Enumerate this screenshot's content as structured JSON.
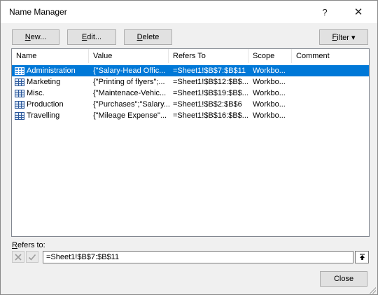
{
  "window": {
    "title": "Name Manager",
    "help_glyph": "?",
    "close_glyph": "✕"
  },
  "toolbar": {
    "new_pre": "",
    "new_u": "N",
    "new_post": "ew...",
    "edit_pre": "",
    "edit_u": "E",
    "edit_post": "dit...",
    "delete_pre": "",
    "delete_u": "D",
    "delete_post": "elete",
    "filter_pre": "",
    "filter_u": "F",
    "filter_post": "ilter ▾"
  },
  "table": {
    "columns": [
      "Name",
      "Value",
      "Refers To",
      "Scope",
      "Comment"
    ],
    "rows": [
      {
        "name": "Administration",
        "value": "{\"Salary-Head Offic...",
        "refers_to": "=Sheet1!$B$7:$B$11",
        "scope": "Workbo...",
        "comment": "",
        "selected": true
      },
      {
        "name": "Marketing",
        "value": "{\"Printing of flyers\";...",
        "refers_to": "=Sheet1!$B$12:$B$...",
        "scope": "Workbo...",
        "comment": "",
        "selected": false
      },
      {
        "name": "Misc.",
        "value": "{\"Maintenace-Vehic...",
        "refers_to": "=Sheet1!$B$19:$B$...",
        "scope": "Workbo...",
        "comment": "",
        "selected": false
      },
      {
        "name": "Production",
        "value": "{\"Purchases\";\"Salary...",
        "refers_to": "=Sheet1!$B$2:$B$6",
        "scope": "Workbo...",
        "comment": "",
        "selected": false
      },
      {
        "name": "Travelling",
        "value": "{\"Mileage Expense\"...",
        "refers_to": "=Sheet1!$B$16:$B$...",
        "scope": "Workbo...",
        "comment": "",
        "selected": false
      }
    ]
  },
  "refers": {
    "label_u": "R",
    "label_post": "efers to:",
    "value": "=Sheet1!$B$7:$B$11",
    "collapse_glyph": "⭱"
  },
  "footer": {
    "close_label": "Close"
  },
  "colors": {
    "selection": "#0078d7",
    "dialog_bg": "#f0f0f0"
  },
  "icons": [
    "help-icon",
    "close-icon",
    "table-icon",
    "cancel-icon",
    "accept-icon",
    "collapse-dialog-icon"
  ]
}
